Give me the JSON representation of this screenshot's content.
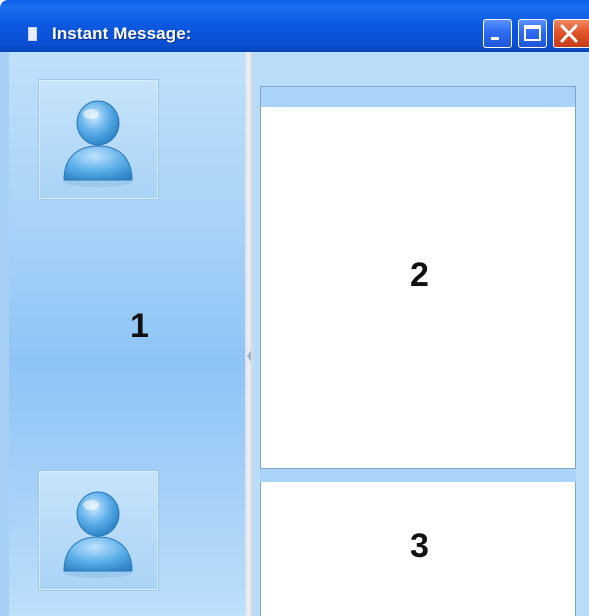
{
  "window": {
    "title": "Instant Message:",
    "controls": {
      "minimize_icon": "minimize-icon",
      "maximize_icon": "maximize-icon",
      "close_icon": "close-icon"
    }
  },
  "colors": {
    "titlebar": "#0a4fd2",
    "pane_background": "#a9d3f8",
    "panel_background": "#ffffff",
    "close_button": "#e2542a"
  },
  "left_pane": {
    "area_number": "1",
    "top_avatar_icon": "user-icon",
    "bottom_avatar_icon": "user-icon"
  },
  "right_pane": {
    "upper_panel_number": "2",
    "lower_panel_number": "3"
  }
}
